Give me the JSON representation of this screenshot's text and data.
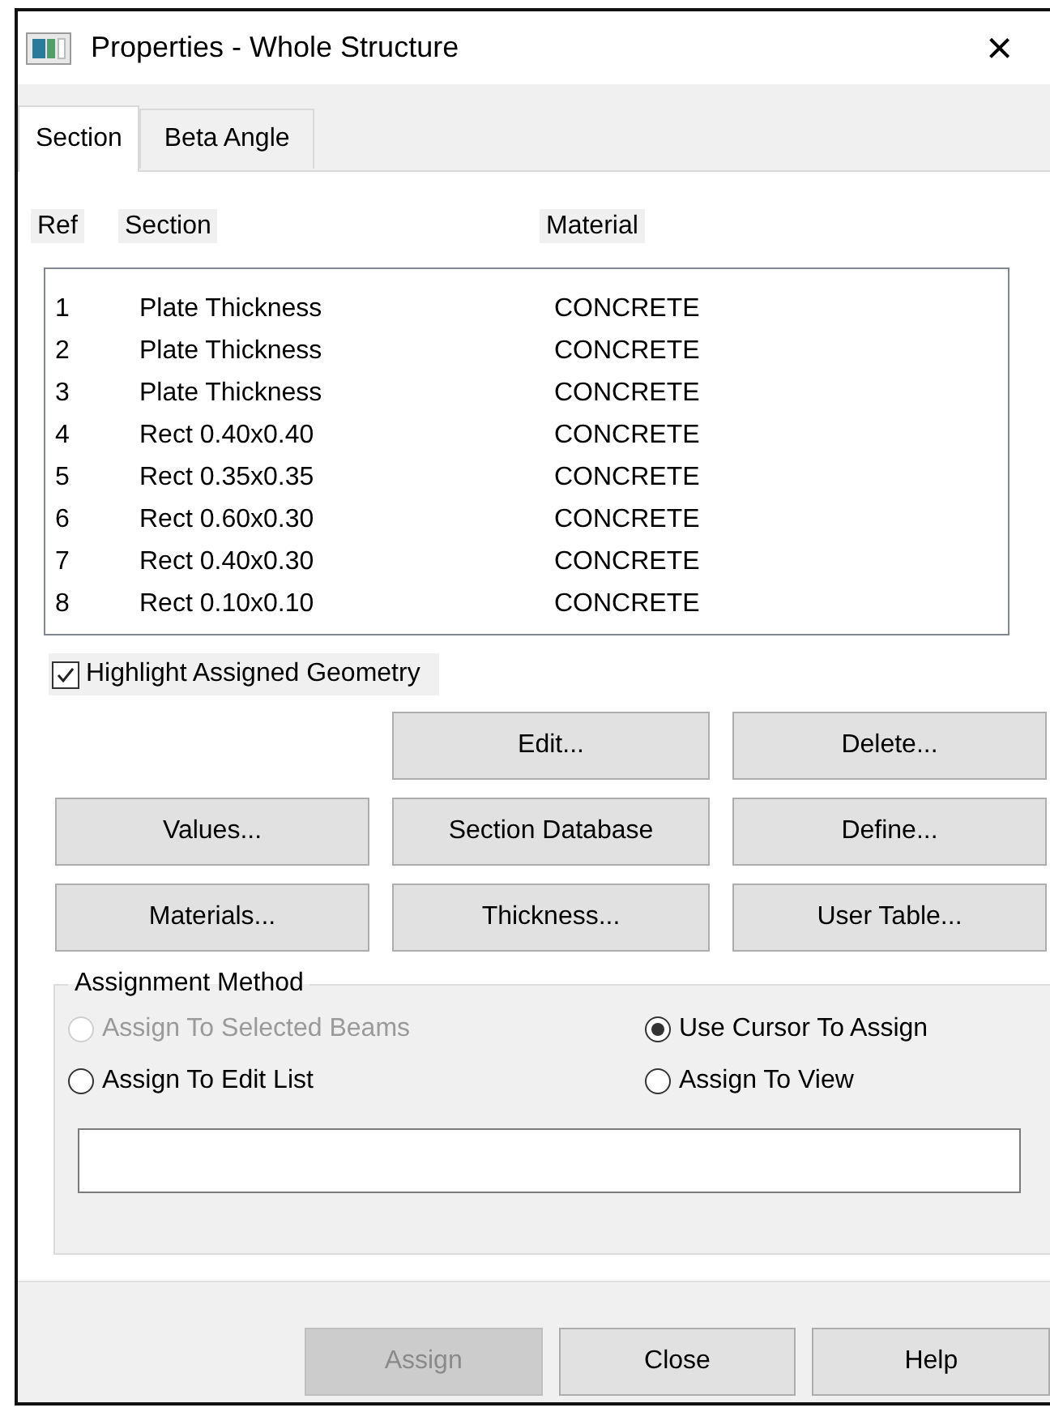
{
  "window": {
    "title": "Properties - Whole Structure",
    "close": "×"
  },
  "tabs": [
    {
      "label": "Section",
      "selected": true
    },
    {
      "label": "Beta Angle",
      "selected": false
    }
  ],
  "table": {
    "columns": [
      "Ref",
      "Section",
      "Material"
    ],
    "rows": [
      {
        "ref": "1",
        "section": "Plate Thickness",
        "material": "CONCRETE"
      },
      {
        "ref": "2",
        "section": "Plate Thickness",
        "material": "CONCRETE"
      },
      {
        "ref": "3",
        "section": "Plate Thickness",
        "material": "CONCRETE"
      },
      {
        "ref": "4",
        "section": "Rect 0.40x0.40",
        "material": "CONCRETE"
      },
      {
        "ref": "5",
        "section": "Rect 0.35x0.35",
        "material": "CONCRETE"
      },
      {
        "ref": "6",
        "section": "Rect 0.60x0.30",
        "material": "CONCRETE"
      },
      {
        "ref": "7",
        "section": "Rect 0.40x0.30",
        "material": "CONCRETE"
      },
      {
        "ref": "8",
        "section": "Rect 0.10x0.10",
        "material": "CONCRETE"
      }
    ]
  },
  "highlight_checkbox": {
    "label": "Highlight Assigned Geometry",
    "checked": true
  },
  "action_buttons": [
    "Edit...",
    "Delete...",
    "Values...",
    "Section Database",
    "Define...",
    "Materials...",
    "Thickness...",
    "User Table..."
  ],
  "assignment_method": {
    "title": "Assignment Method",
    "options": [
      {
        "label": "Assign To Selected Beams",
        "selected": false,
        "disabled": true
      },
      {
        "label": "Use Cursor To Assign",
        "selected": true,
        "disabled": false
      },
      {
        "label": "Assign To Edit List",
        "selected": false,
        "disabled": false
      },
      {
        "label": "Assign To View",
        "selected": false,
        "disabled": false
      }
    ]
  },
  "footer_buttons": [
    {
      "label": "Assign",
      "disabled": true
    },
    {
      "label": "Close",
      "disabled": false
    },
    {
      "label": "Help",
      "disabled": false
    }
  ]
}
